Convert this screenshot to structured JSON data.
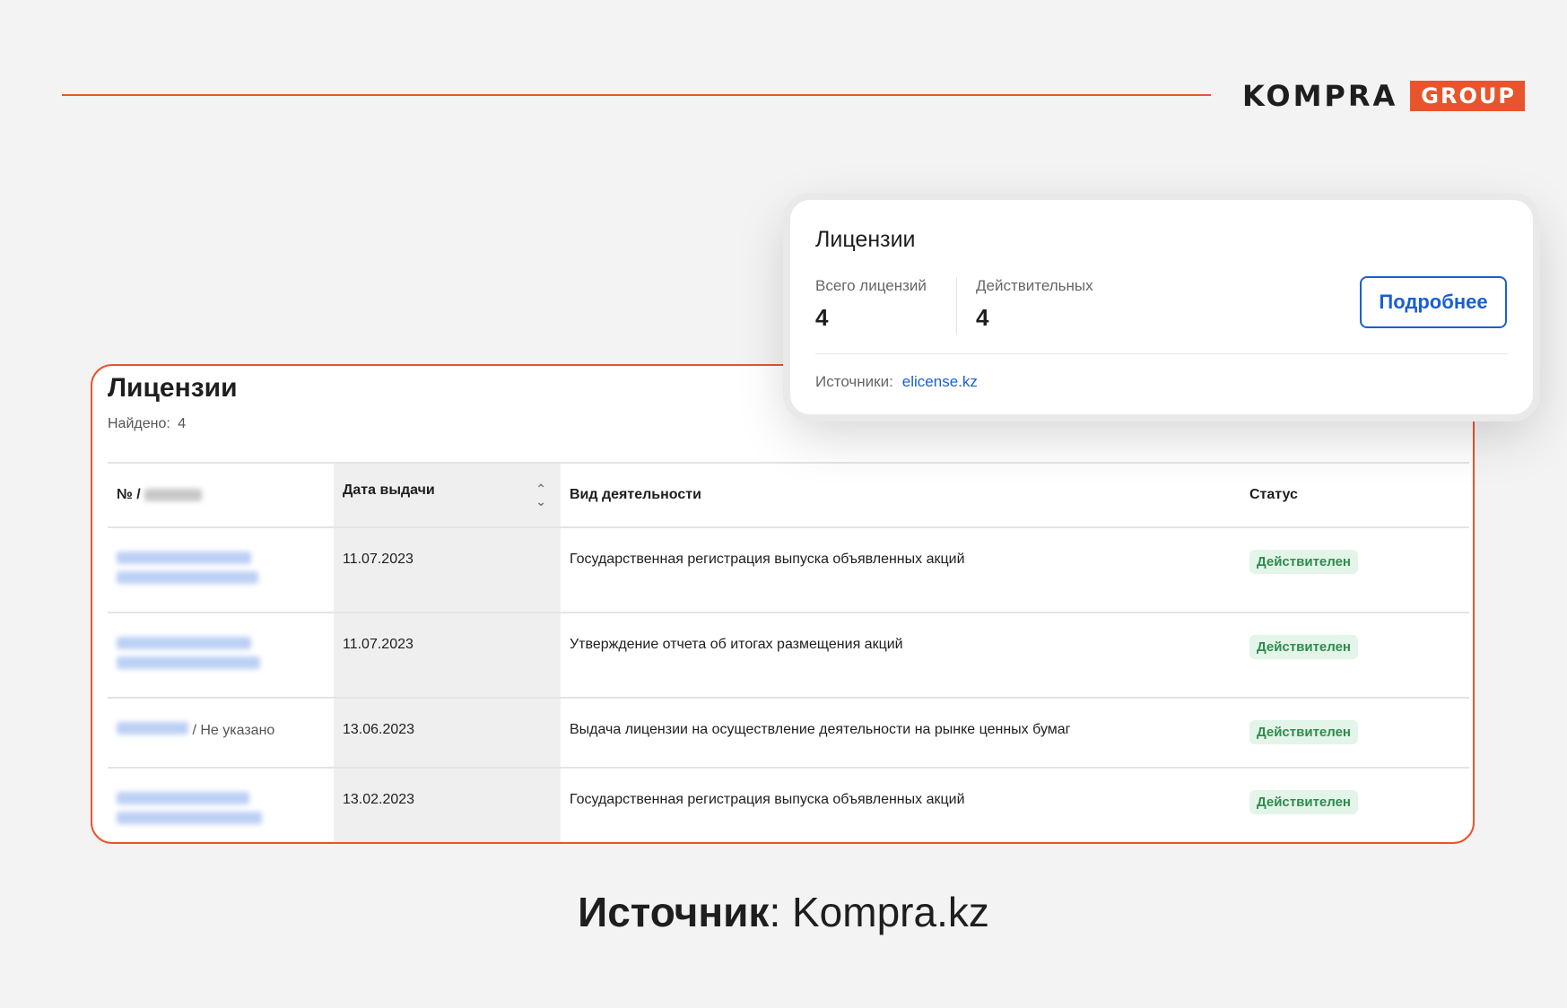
{
  "brand": {
    "name": "KOMPRA",
    "tag": "GROUP",
    "accent": "#e8552c"
  },
  "popup": {
    "title": "Лицензии",
    "total_label": "Всего лицензий",
    "total_value": "4",
    "valid_label": "Действительных",
    "valid_value": "4",
    "details_button": "Подробнее",
    "sources_label": "Источники:",
    "source_link": "elicense.kz"
  },
  "table_card": {
    "title": "Лицензии",
    "found_label": "Найдено:",
    "found_value": "4",
    "columns": {
      "number": "№ /",
      "date": "Дата выдачи",
      "activity": "Вид деятельности",
      "status": "Статус"
    },
    "rows": [
      {
        "date": "11.07.2023",
        "activity": "Государственная регистрация выпуска объявленных акций",
        "status": "Действителен",
        "second": ""
      },
      {
        "date": "11.07.2023",
        "activity": "Утверждение отчета об итогах размещения акций",
        "status": "Действителен",
        "second": ""
      },
      {
        "date": "13.06.2023",
        "activity": "Выдача лицензии на осуществление деятельности на рынке ценных бумаг",
        "status": "Действителен",
        "second": "Не указано"
      },
      {
        "date": "13.02.2023",
        "activity": "Государственная регистрация выпуска объявленных акций",
        "status": "Действителен",
        "second": ""
      }
    ]
  },
  "footer": {
    "source_label": "Источник",
    "source_value": "Kompra.kz"
  },
  "colors": {
    "status_bg": "#e3f5e8",
    "status_text": "#2e8b4e",
    "link": "#1a5fd0"
  }
}
